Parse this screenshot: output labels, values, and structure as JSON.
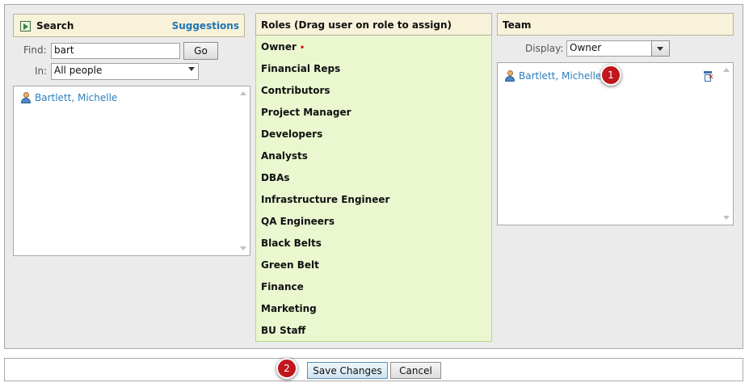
{
  "search": {
    "title": "Search",
    "suggestions_label": "Suggestions",
    "find_label": "Find:",
    "find_value": "bart",
    "go_label": "Go",
    "in_label": "In:",
    "in_value": "All people",
    "results": [
      {
        "name": "Bartlett, Michelle",
        "icon": "person-icon"
      }
    ]
  },
  "roles": {
    "title": "Roles (Drag user on role to assign)",
    "items": [
      {
        "label": "Owner",
        "marker": "•"
      },
      {
        "label": "Financial Reps"
      },
      {
        "label": "Contributors"
      },
      {
        "label": "Project Manager"
      },
      {
        "label": "Developers"
      },
      {
        "label": "Analysts"
      },
      {
        "label": "DBAs"
      },
      {
        "label": "Infrastructure Engineer"
      },
      {
        "label": "QA Engineers"
      },
      {
        "label": "Black Belts"
      },
      {
        "label": "Green Belt"
      },
      {
        "label": "Finance"
      },
      {
        "label": "Marketing"
      },
      {
        "label": "BU Staff"
      }
    ]
  },
  "team": {
    "title": "Team",
    "display_label": "Display:",
    "display_value": "Owner",
    "members": [
      {
        "name": "Bartlett, Michelle",
        "icon": "person-icon",
        "action_icon": "delete-icon"
      }
    ]
  },
  "footer": {
    "save_label": "Save Changes",
    "cancel_label": "Cancel"
  },
  "callouts": [
    "1",
    "2"
  ],
  "colors": {
    "header_bg": "#f7f2d9",
    "role_bg": "#eaf7cf",
    "link": "#2c7fba",
    "callout": "#c0161c"
  }
}
